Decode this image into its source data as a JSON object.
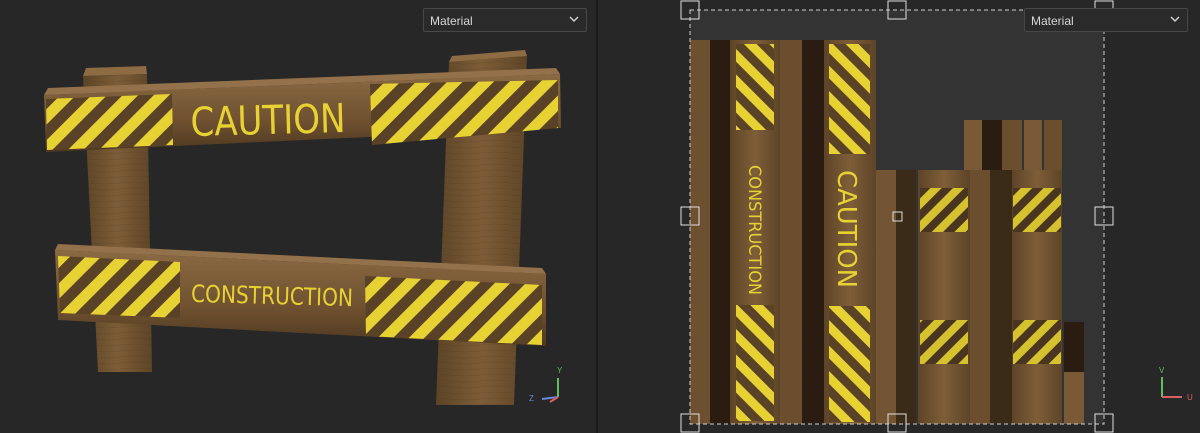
{
  "viewport_3d": {
    "material_dropdown": {
      "value": "Material"
    },
    "axis_gizmo": {
      "y": "Y",
      "z": "Z"
    },
    "barrier": {
      "top_text": "CAUTION",
      "bottom_text": "CONSTRUCTION"
    }
  },
  "viewport_2d": {
    "material_dropdown": {
      "value": "Material"
    },
    "axis_gizmo": {
      "v": "V",
      "u": "U"
    },
    "uv_labels": {
      "caution": "CAUTION",
      "construction": "CONSTRUCTION"
    }
  },
  "colors": {
    "background": "#272727",
    "wood": "#7a5a35",
    "stripe_yellow": "#e7d233",
    "stripe_dark": "#5a4226",
    "uv_area": "#333333",
    "axis_green": "#5fbf5f",
    "axis_red": "#d86060",
    "axis_blue": "#6a86d6"
  }
}
